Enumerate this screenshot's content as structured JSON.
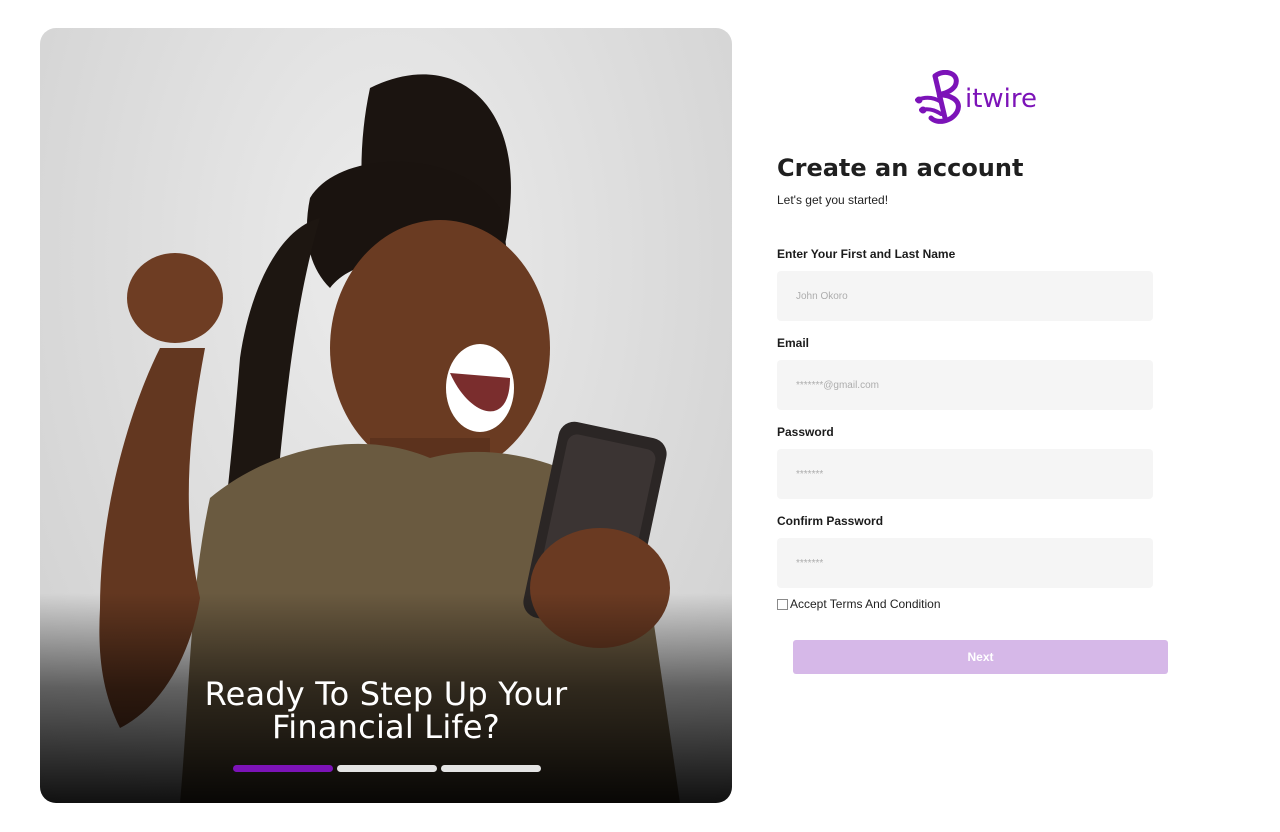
{
  "hero": {
    "caption_line1": "Ready To Step Up Your",
    "caption_line2": "Financial Life?",
    "carousel": {
      "total": 3,
      "active_index": 0
    }
  },
  "brand": {
    "name": "itwire",
    "color": "#7c13b8"
  },
  "form": {
    "title": "Create an account",
    "subtitle": "Let's get you started!",
    "fields": [
      {
        "label": "Enter Your First and Last Name",
        "placeholder": "John Okoro",
        "value": ""
      },
      {
        "label": "Email",
        "placeholder": "*******@gmail.com",
        "value": ""
      },
      {
        "label": "Password",
        "placeholder": "*******",
        "value": ""
      },
      {
        "label": "Confirm Password",
        "placeholder": "*******",
        "value": ""
      }
    ],
    "terms_label": "Accept Terms And Condition",
    "terms_checked": false,
    "submit_label": "Next",
    "submit_color": "#d6b8e8"
  }
}
